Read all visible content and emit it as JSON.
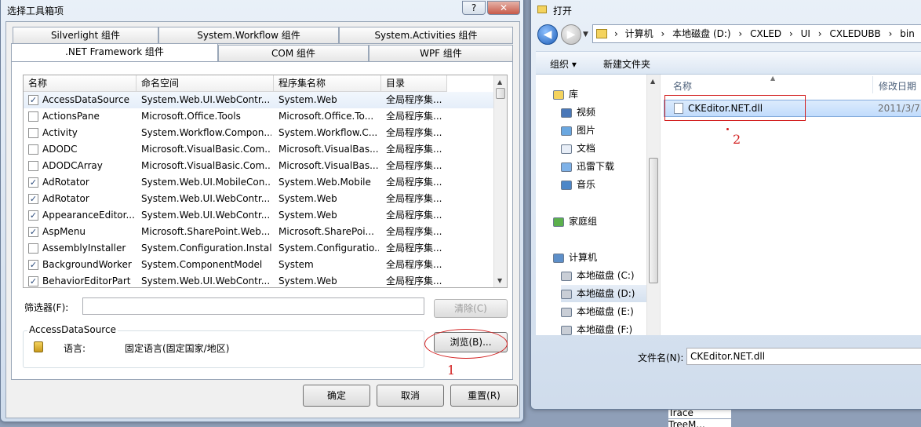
{
  "toolbox": {
    "title": "选择工具箱项",
    "help_btn": "?",
    "close_btn": "✕",
    "tabs_back": [
      "Silverlight 组件",
      "System.Workflow 组件",
      "System.Activities 组件"
    ],
    "tabs_front": [
      ".NET Framework 组件",
      "COM 组件",
      "WPF 组件"
    ],
    "columns": [
      "名称",
      "命名空间",
      "程序集名称",
      "目录"
    ],
    "rows": [
      {
        "checked": true,
        "name": "AccessDataSource",
        "ns": "System.Web.UI.WebContr...",
        "asm": "System.Web",
        "dir": "全局程序集..."
      },
      {
        "checked": false,
        "name": "ActionsPane",
        "ns": "Microsoft.Office.Tools",
        "asm": "Microsoft.Office.To...",
        "dir": "全局程序集..."
      },
      {
        "checked": false,
        "name": "Activity",
        "ns": "System.Workflow.Compon...",
        "asm": "System.Workflow.C...",
        "dir": "全局程序集..."
      },
      {
        "checked": false,
        "name": "ADODC",
        "ns": "Microsoft.VisualBasic.Com...",
        "asm": "Microsoft.VisualBas...",
        "dir": "全局程序集..."
      },
      {
        "checked": false,
        "name": "ADODCArray",
        "ns": "Microsoft.VisualBasic.Com...",
        "asm": "Microsoft.VisualBas...",
        "dir": "全局程序集..."
      },
      {
        "checked": true,
        "name": "AdRotator",
        "ns": "System.Web.UI.MobileCon...",
        "asm": "System.Web.Mobile",
        "dir": "全局程序集..."
      },
      {
        "checked": true,
        "name": "AdRotator",
        "ns": "System.Web.UI.WebContr...",
        "asm": "System.Web",
        "dir": "全局程序集..."
      },
      {
        "checked": true,
        "name": "AppearanceEditor...",
        "ns": "System.Web.UI.WebContr...",
        "asm": "System.Web",
        "dir": "全局程序集..."
      },
      {
        "checked": true,
        "name": "AspMenu",
        "ns": "Microsoft.SharePoint.Web...",
        "asm": "Microsoft.SharePoi...",
        "dir": "全局程序集..."
      },
      {
        "checked": false,
        "name": "AssemblyInstaller",
        "ns": "System.Configuration.Install",
        "asm": "System.Configuratio...",
        "dir": "全局程序集..."
      },
      {
        "checked": true,
        "name": "BackgroundWorker",
        "ns": "System.ComponentModel",
        "asm": "System",
        "dir": "全局程序集..."
      },
      {
        "checked": true,
        "name": "BehaviorEditorPart",
        "ns": "System.Web.UI.WebContr...",
        "asm": "System.Web",
        "dir": "全局程序集..."
      }
    ],
    "filter_label": "筛选器(F):",
    "filter_value": "",
    "clear_btn": "清除(C)",
    "info_title": "AccessDataSource",
    "lang_label": "语言:",
    "lang_value": "固定语言(固定国家/地区)",
    "browse_btn": "浏览(B)...",
    "ok_btn": "确定",
    "cancel_btn": "取消",
    "reset_btn": "重置(R)"
  },
  "open": {
    "title": "打开",
    "breadcrumb": [
      "计算机",
      "本地磁盘 (D:)",
      "CXLED",
      "UI",
      "CXLEDUBB",
      "bin"
    ],
    "organize": "组织 ▾",
    "new_folder": "新建文件夹",
    "nav": [
      {
        "label": "库",
        "icon": "library"
      },
      {
        "label": "视频",
        "icon": "video"
      },
      {
        "label": "图片",
        "icon": "picture"
      },
      {
        "label": "文档",
        "icon": "document"
      },
      {
        "label": "迅雷下载",
        "icon": "download"
      },
      {
        "label": "音乐",
        "icon": "music"
      },
      {
        "label": "家庭组",
        "icon": "homegroup"
      },
      {
        "label": "计算机",
        "icon": "computer"
      },
      {
        "label": "本地磁盘 (C:)",
        "icon": "drive"
      },
      {
        "label": "本地磁盘 (D:)",
        "icon": "drive"
      },
      {
        "label": "本地磁盘 (E:)",
        "icon": "drive"
      },
      {
        "label": "本地磁盘 (F:)",
        "icon": "drive"
      }
    ],
    "col_name": "名称",
    "col_date": "修改日期",
    "file_name": "CKEditor.NET.dll",
    "file_date": "2011/3/7",
    "filename_label": "文件名(N):",
    "filename_value": "CKEditor.NET.dll"
  },
  "background": {
    "item": "Trace",
    "item2": "TreeM..."
  },
  "annotations": {
    "one": "1",
    "two": "2"
  }
}
